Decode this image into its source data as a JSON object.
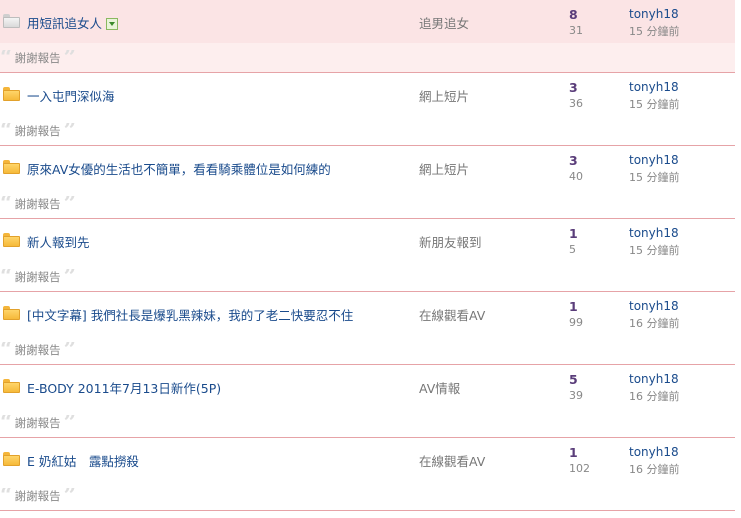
{
  "colors": {
    "highlight_row": "#fdeeee",
    "divider": "#e6a3a7",
    "title_link": "#1a4b8c",
    "reply_count": "#5a3d7a"
  },
  "threads": [
    {
      "title": "用短訊追女人",
      "has_attachment": true,
      "forum": "追男追女",
      "replies": "8",
      "views": "31",
      "last_user": "tonyh18",
      "last_time": "15 分鐘前",
      "report": "謝謝報告",
      "folder_icon": "folder-grey-icon"
    },
    {
      "title": "一入屯門深似海",
      "forum": "網上短片",
      "replies": "3",
      "views": "36",
      "last_user": "tonyh18",
      "last_time": "15 分鐘前",
      "report": "謝謝報告",
      "folder_icon": "folder-icon"
    },
    {
      "title": "原來AV女優的生活也不簡單，看看騎乘體位是如何練的",
      "forum": "網上短片",
      "replies": "3",
      "views": "40",
      "last_user": "tonyh18",
      "last_time": "15 分鐘前",
      "report": "謝謝報告",
      "folder_icon": "folder-icon"
    },
    {
      "title": "新人報到先",
      "forum": "新朋友報到",
      "replies": "1",
      "views": "5",
      "last_user": "tonyh18",
      "last_time": "15 分鐘前",
      "report": "謝謝報告",
      "folder_icon": "folder-icon"
    },
    {
      "title": "[中文字幕] 我們社長是爆乳黑辣妹，我的了老二快要忍不住",
      "forum": "在線觀看AV",
      "replies": "1",
      "views": "99",
      "last_user": "tonyh18",
      "last_time": "16 分鐘前",
      "report": "謝謝報告",
      "folder_icon": "folder-icon"
    },
    {
      "title": "E-BODY 2011年7月13日新作(5P)",
      "forum": "AV情報",
      "replies": "5",
      "views": "39",
      "last_user": "tonyh18",
      "last_time": "16 分鐘前",
      "report": "謝謝報告",
      "folder_icon": "folder-icon"
    },
    {
      "title": "E 奶紅姑　露點撈殺",
      "forum": "在線觀看AV",
      "replies": "1",
      "views": "102",
      "last_user": "tonyh18",
      "last_time": "16 分鐘前",
      "report": "謝謝報告",
      "folder_icon": "folder-icon"
    }
  ]
}
